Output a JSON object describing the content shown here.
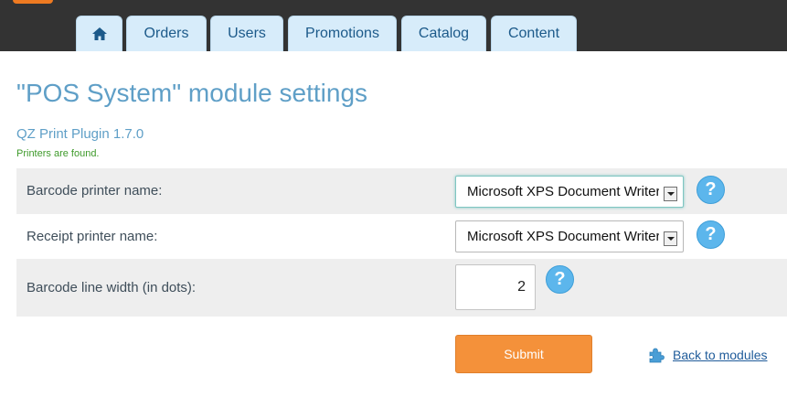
{
  "nav": {
    "tabs": [
      {
        "label": "",
        "icon": "home-icon"
      },
      {
        "label": "Orders"
      },
      {
        "label": "Users"
      },
      {
        "label": "Promotions"
      },
      {
        "label": "Catalog"
      },
      {
        "label": "Content"
      }
    ]
  },
  "page": {
    "title": "\"POS System\" module settings",
    "subtitle": "QZ Print Plugin 1.7.0",
    "status": "Printers are found."
  },
  "settings": {
    "barcode_printer": {
      "label": "Barcode printer name:",
      "value": "Microsoft XPS Document Writer",
      "help": "?"
    },
    "receipt_printer": {
      "label": "Receipt printer name:",
      "value": "Microsoft XPS Document Writer",
      "help": "?"
    },
    "line_width": {
      "label": "Barcode line width (in dots):",
      "value": "2",
      "help": "?"
    }
  },
  "actions": {
    "submit_label": "Submit",
    "back_label": "Back to modules",
    "back_icon": "puzzle-piece-icon"
  },
  "colors": {
    "topbar": "#333333",
    "tab": "#d7ecfa",
    "title": "#5f9fc7",
    "status": "#3e9a2a",
    "submit": "#f4913a",
    "help": "#5cb6ec",
    "link": "#1f5b9a"
  }
}
